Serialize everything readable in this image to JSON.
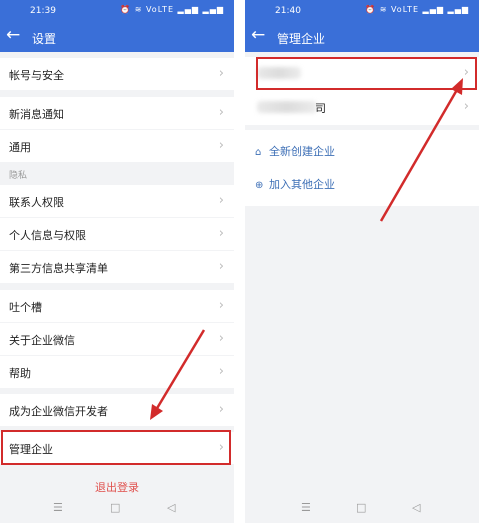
{
  "left": {
    "time": "21:39",
    "status_icons": "⏰ ≋ VoLTE ▂▄▆ ▂▄▆",
    "title": "设置",
    "items": [
      {
        "label": "帐号与安全"
      },
      {
        "label": "新消息通知"
      },
      {
        "label": "通用"
      },
      {
        "label": "联系人权限"
      },
      {
        "label": "个人信息与权限"
      },
      {
        "label": "第三方信息共享清单"
      },
      {
        "label": "吐个槽"
      },
      {
        "label": "关于企业微信"
      },
      {
        "label": "帮助"
      },
      {
        "label": "成为企业微信开发者"
      },
      {
        "label": "管理企业"
      }
    ],
    "section_label": "隐私",
    "logout": "退出登录"
  },
  "right": {
    "time": "21:40",
    "status_icons": "⏰ ≋ VoLTE ▂▄▆ ▂▄▆",
    "title": "管理企业",
    "company_suffix": "司",
    "links": [
      {
        "icon": "home-icon",
        "label": "全新创建企业"
      },
      {
        "icon": "plus-circle-icon",
        "label": "加入其他企业"
      }
    ]
  },
  "icons": {
    "back": "←",
    "chevron": "›",
    "home": "⌂",
    "plus": "⊕",
    "nav_menu": "☰",
    "nav_home": "□",
    "nav_back": "◁"
  },
  "colors": {
    "header": "#3a6fd8",
    "highlight": "#d22b2b",
    "link": "#3d6fb6",
    "logout": "#e0524f"
  }
}
